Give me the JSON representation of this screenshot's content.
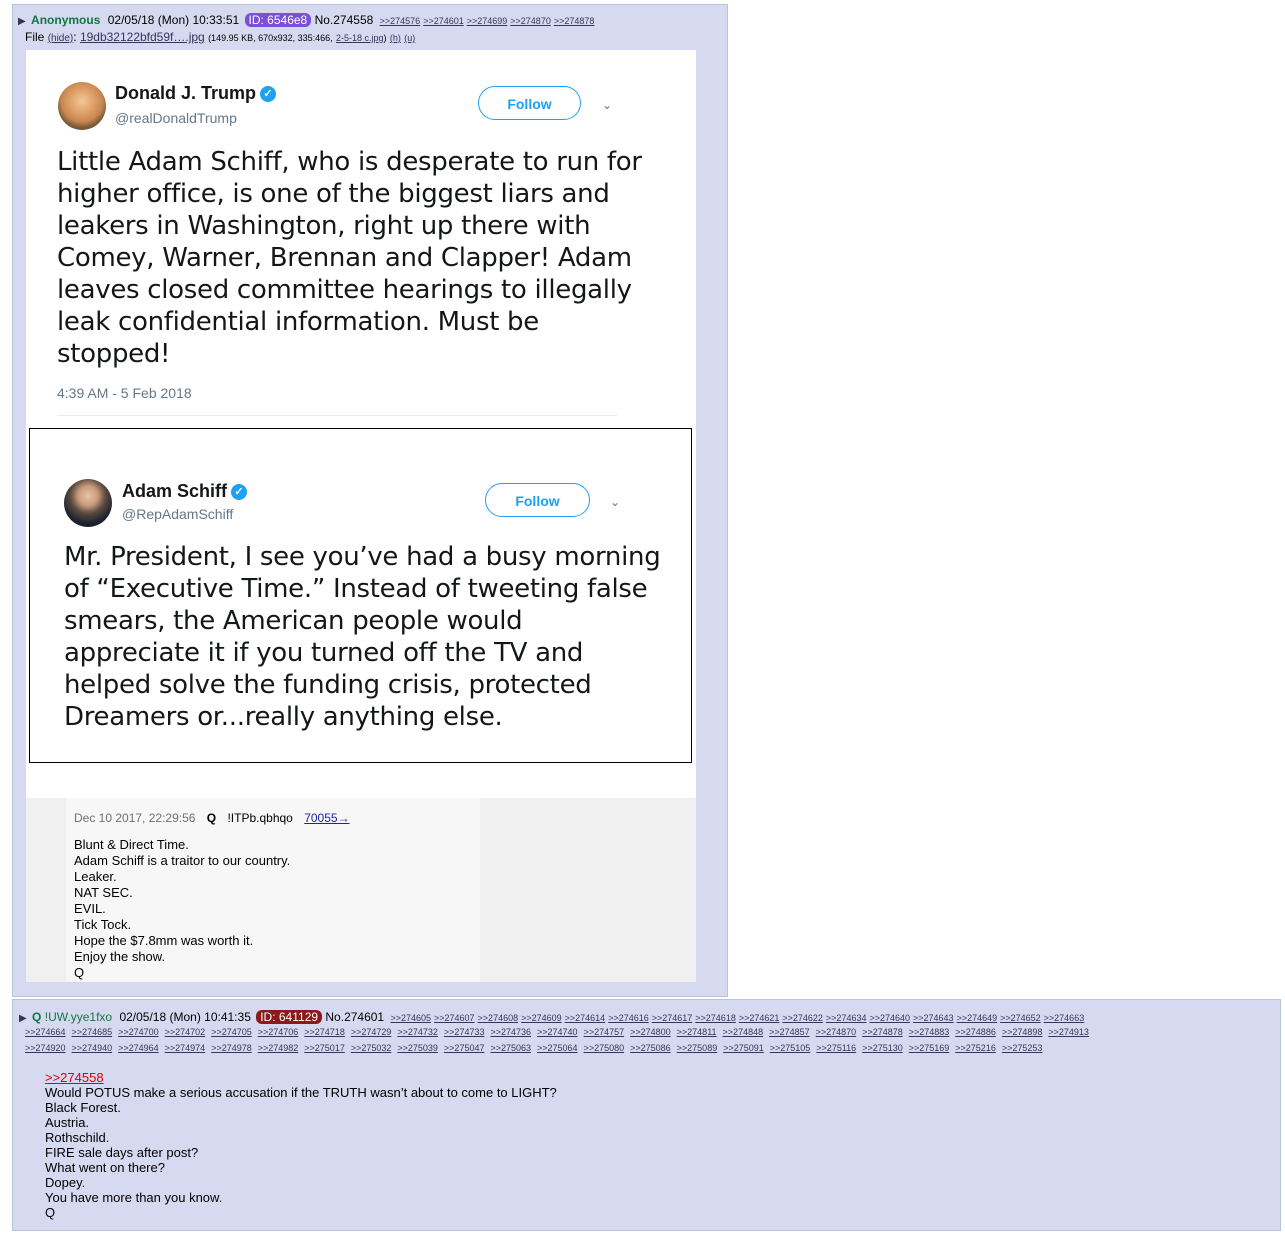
{
  "post1": {
    "name": "Anonymous",
    "datetime": "02/05/18 (Mon) 10:33:51",
    "id_label": "ID: 6546e8",
    "number": "No.274558",
    "backlinks": [
      ">>274576",
      ">>274601",
      ">>274699",
      ">>274870",
      ">>274878"
    ],
    "file_label": "File",
    "file_hide": "(hide)",
    "file_name": "19db32122bfd59f….jpg",
    "file_info": "(149.95 KB, 670x932, 335:466,",
    "file_orig": "2-5-18 c.jpg",
    "file_tail": ")",
    "file_h": "(h)",
    "file_u": "(u)"
  },
  "trump_tweet": {
    "name": "Donald J. Trump",
    "handle": "@realDonaldTrump",
    "follow": "Follow",
    "text": "Little Adam Schiff, who is desperate to run for higher office, is one of the biggest liars and leakers in Washington, right up there with Comey, Warner, Brennan and Clapper! Adam leaves closed committee hearings to illegally leak confidential information. Must be stopped!",
    "time": "4:39 AM - 5 Feb 2018"
  },
  "schiff_tweet": {
    "name": "Adam Schiff",
    "handle": "@RepAdamSchiff",
    "follow": "Follow",
    "text": "Mr. President, I see you’ve had a busy morning of “Executive Time.” Instead of tweeting false smears, the American people would appreciate it if you turned off the TV and helped solve the funding crisis, protected Dreamers or...really anything else."
  },
  "q_drop": {
    "date": "Dec 10 2017, 22:29:56",
    "label": "Q",
    "trip": "!ITPb.qbhqo",
    "number": "70055→",
    "lines": [
      "Blunt & Direct Time.",
      "Adam Schiff is a traitor to our country.",
      "Leaker.",
      "NAT SEC.",
      "EVIL.",
      "Tick Tock.",
      "Hope the $7.8mm was worth it.",
      "Enjoy the show.",
      "Q"
    ]
  },
  "post2": {
    "name": "Q",
    "trip": "!UW.yye1fxo",
    "datetime": "02/05/18 (Mon) 10:41:35",
    "id_label": "ID: 641129",
    "number": "No.274601",
    "backlinks_row1": [
      ">>274605",
      ">>274607",
      ">>274608",
      ">>274609",
      ">>274614",
      ">>274616",
      ">>274617",
      ">>274618",
      ">>274621",
      ">>274622",
      ">>274634",
      ">>274640",
      ">>274643",
      ">>274649",
      ">>274652",
      ">>274663"
    ],
    "backlinks_row2": [
      ">>274664",
      ">>274685",
      ">>274700",
      ">>274702",
      ">>274705",
      ">>274706",
      ">>274718",
      ">>274729",
      ">>274732",
      ">>274733",
      ">>274736",
      ">>274740",
      ">>274757",
      ">>274800",
      ">>274811",
      ">>274848",
      ">>274857",
      ">>274870",
      ">>274878",
      ">>274883",
      ">>274886",
      ">>274898",
      ">>274913"
    ],
    "backlinks_row3": [
      ">>274920",
      ">>274940",
      ">>274964",
      ">>274974",
      ">>274978",
      ">>274982",
      ">>275017",
      ">>275032",
      ">>275039",
      ">>275047",
      ">>275063",
      ">>275064",
      ">>275080",
      ">>275086",
      ">>275089",
      ">>275091",
      ">>275105",
      ">>275116",
      ">>275130",
      ">>275169",
      ">>275216",
      ">>275253"
    ],
    "quote": ">>274558",
    "lines": [
      "Would POTUS make a serious accusation if the TRUTH wasn’t about to come to LIGHT?",
      "Black Forest.",
      "Austria.",
      "Rothschild.",
      "FIRE sale days after post?",
      "What went on there?",
      "Dopey.",
      "You have more than you know.",
      "Q"
    ]
  }
}
